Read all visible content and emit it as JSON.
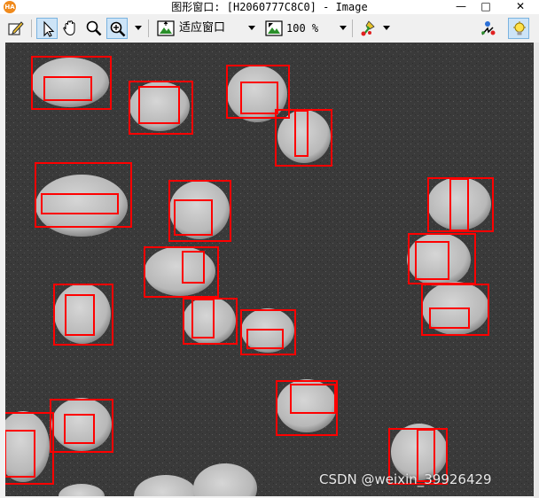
{
  "window": {
    "app_icon_text": "HA",
    "title": "图形窗口: [H2060777C8C0] - Image",
    "minimize_glyph": "—",
    "maximize_glyph": "□",
    "close_glyph": "✕"
  },
  "toolbar": {
    "zoom_mode_label": "适应窗口",
    "zoom_percent_label": "100 %"
  },
  "colors": {
    "box": "#ff0000",
    "background": "#3a3a3a",
    "object": "#c8c8c8"
  },
  "watermark": "CSDN @weixin_39926429"
}
